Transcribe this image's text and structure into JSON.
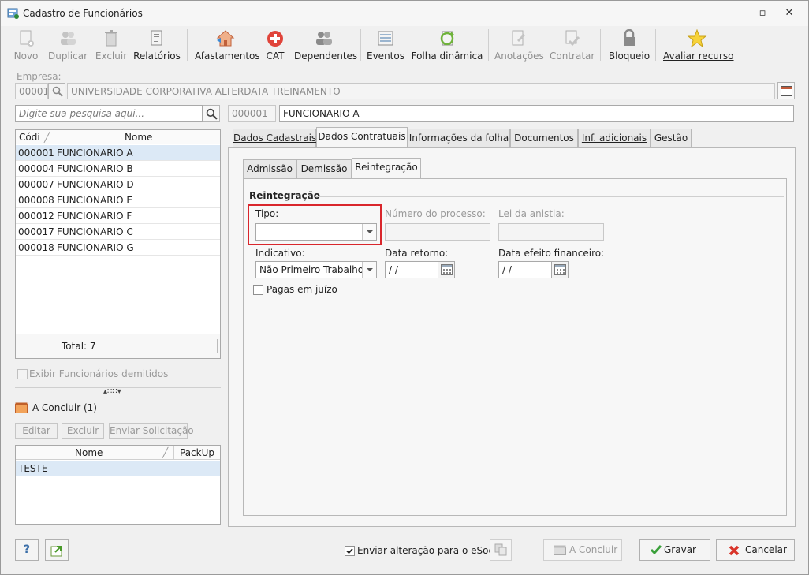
{
  "window": {
    "title": "Cadastro de Funcionários",
    "restore_glyph": "▫",
    "close_glyph": "✕"
  },
  "toolbar": {
    "items": [
      {
        "label": "Novo",
        "icon": "new-icon",
        "enabled": false
      },
      {
        "label": "Duplicar",
        "icon": "duplicate-icon",
        "enabled": false
      },
      {
        "label": "Excluir",
        "icon": "trash-icon",
        "enabled": false
      },
      {
        "label": "Relatórios",
        "icon": "report-icon",
        "enabled": true
      },
      {
        "label": "Afastamentos",
        "icon": "house-icon",
        "enabled": true
      },
      {
        "label": "CAT",
        "icon": "medical-cross-icon",
        "enabled": true
      },
      {
        "label": "Dependentes",
        "icon": "people-icon",
        "enabled": true
      },
      {
        "label": "Eventos",
        "icon": "list-icon",
        "enabled": true
      },
      {
        "label": "Folha dinâmica",
        "icon": "refresh-sheet-icon",
        "enabled": true
      },
      {
        "label": "Anotações",
        "icon": "notes-icon",
        "enabled": false
      },
      {
        "label": "Contratar",
        "icon": "hire-icon",
        "enabled": false
      },
      {
        "label": "Bloqueio",
        "icon": "lock-icon",
        "enabled": true
      },
      {
        "label": "Avaliar recurso",
        "icon": "star-icon",
        "enabled": true
      }
    ]
  },
  "empresa": {
    "label": "Empresa:",
    "code": "00001",
    "name": "UNIVERSIDADE CORPORATIVA ALTERDATA TREINAMENTO"
  },
  "search": {
    "placeholder": "Digite sua pesquisa aqui..."
  },
  "employee_list": {
    "columns": {
      "code": "Códi",
      "name": "Nome"
    },
    "rows": [
      {
        "code": "000001",
        "name": "FUNCIONARIO A"
      },
      {
        "code": "000004",
        "name": "FUNCIONARIO B"
      },
      {
        "code": "000007",
        "name": "FUNCIONARIO D"
      },
      {
        "code": "000008",
        "name": "FUNCIONARIO E"
      },
      {
        "code": "000012",
        "name": "FUNCIONARIO F"
      },
      {
        "code": "000017",
        "name": "FUNCIONARIO C"
      },
      {
        "code": "000018",
        "name": "FUNCIONARIO G"
      }
    ],
    "total": "Total: 7",
    "show_dismissed_label": "Exibir Funcionários demitidos"
  },
  "pending": {
    "title": "A Concluir (1)",
    "buttons": {
      "edit": "Editar",
      "delete": "Excluir",
      "send": "Enviar Solicitação"
    },
    "columns": {
      "name": "Nome",
      "packup": "PackUp"
    },
    "rows": [
      {
        "name": "TESTE",
        "packup": ""
      }
    ]
  },
  "employee": {
    "code": "000001",
    "name": "FUNCIONARIO A"
  },
  "tabs": [
    {
      "label": "Dados Cadastrais"
    },
    {
      "label": "Dados Contratuais"
    },
    {
      "label": "Informações da folha"
    },
    {
      "label": "Documentos"
    },
    {
      "label": "Inf. adicionais"
    },
    {
      "label": "Gestão"
    }
  ],
  "subtabs": [
    {
      "label": "Admissão"
    },
    {
      "label": "Demissão"
    },
    {
      "label": "Reintegração"
    }
  ],
  "reintegracao": {
    "group_label": "Reintegração",
    "tipo_label": "Tipo:",
    "tipo_value": "",
    "numero_label": "Número do processo:",
    "lei_label": "Lei da anistia:",
    "indicativo_label": "Indicativo:",
    "indicativo_value": "Não Primeiro Trabalho",
    "data_retorno_label": "Data retorno:",
    "data_retorno_value": " / /",
    "data_efeito_label": "Data efeito financeiro:",
    "data_efeito_value": " / /",
    "pagas_label": "Pagas em juízo"
  },
  "footer": {
    "help": "?",
    "esocial_label": "Enviar alteração para o eSocial",
    "esocial_checked": true,
    "conclude": "A Concluir",
    "save": "Gravar",
    "cancel": "Cancelar"
  },
  "colors": {
    "highlight": "#d9262c",
    "selection": "#dce9f6"
  }
}
